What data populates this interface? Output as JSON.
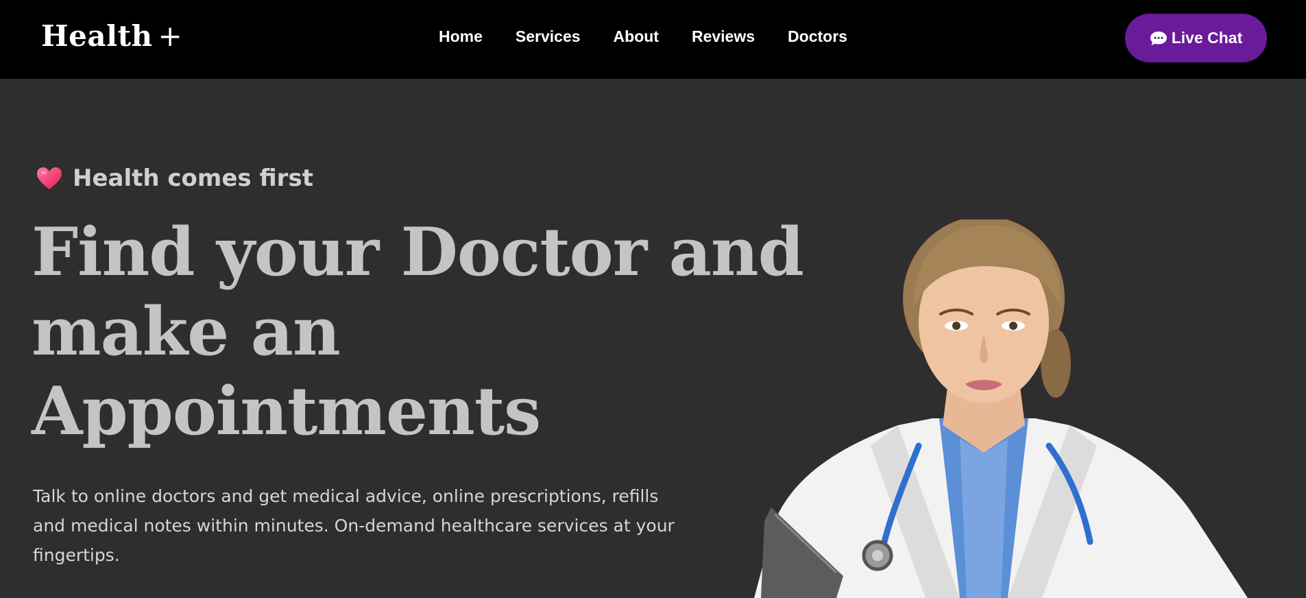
{
  "header": {
    "logo_text": "Health",
    "logo_plus": "+",
    "nav": [
      "Home",
      "Services",
      "About",
      "Reviews",
      "Doctors"
    ],
    "live_chat_label": "Live Chat"
  },
  "hero": {
    "tagline": "Health comes first",
    "headline_lines": [
      "Find your Doctor and",
      "make an",
      "Appointments"
    ],
    "description_lines": [
      "Talk to online doctors and get medical advice, online prescriptions, refills",
      "and medical notes within minutes. On-demand healthcare services at your",
      "fingertips."
    ],
    "image": "doctor-photo"
  },
  "colors": {
    "nav_bg": "#000000",
    "page_bg": "#2e2e2e",
    "accent": "#6a1b9a",
    "heart": "#ff3b6b",
    "headline": "#c4c4c4"
  }
}
